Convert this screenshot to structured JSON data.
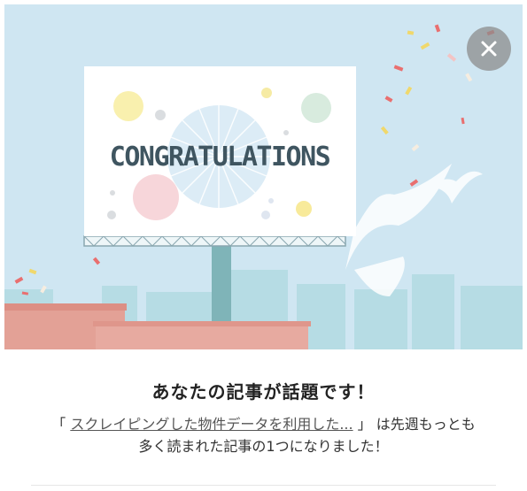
{
  "banner": {
    "sign_text": "CONGRATULATIONS",
    "colors": {
      "sky": "#cfe6f2",
      "sign": "#ffffff",
      "text": "#3f5560",
      "building_red": "#e3a196",
      "buildings_blue": "#b3dbe3"
    }
  },
  "close_button": {
    "icon": "close-icon"
  },
  "message": {
    "headline": "あなたの記事が話題です！",
    "open_bracket": "「",
    "article_link": "スクレイピングした物件データを利用した...",
    "close_bracket": "」",
    "line1_suffix": "は先週もっとも",
    "line2": "多く読まれた記事の1つになりました！"
  }
}
